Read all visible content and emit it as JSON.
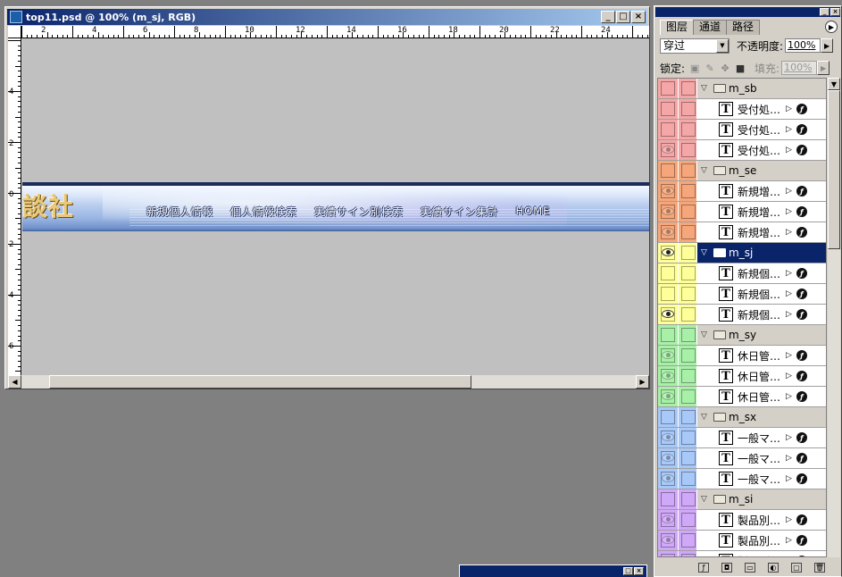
{
  "document": {
    "title": "top11.psd @ 100% (m_sj, RGB)",
    "window_buttons": {
      "minimize": "_",
      "maximize": "□",
      "close": "×"
    },
    "hruler_labels": [
      "2",
      "4",
      "6",
      "8",
      "10",
      "12",
      "14",
      "16",
      "18",
      "20",
      "22",
      "24"
    ],
    "vruler_labels": [
      "4",
      "2",
      "0",
      "2",
      "4",
      "6"
    ],
    "banner": {
      "logo_text": "談社",
      "nav": [
        "新規個人情報",
        "個人情報検索",
        "実績サイン別検索",
        "実績サイン集計",
        "HOME"
      ]
    }
  },
  "layers_panel": {
    "tabs": [
      "图层",
      "通道",
      "路径"
    ],
    "blend_mode": "穿过",
    "opacity_label": "不透明度:",
    "opacity_value": "100%",
    "lock_label": "锁定:",
    "fill_label": "填充:",
    "fill_value": "100%",
    "groups": [
      {
        "name": "m_sb",
        "color": "#f5a6a6",
        "selected": false,
        "layers": [
          {
            "name": "受付処…",
            "eye": false
          },
          {
            "name": "受付処…",
            "eye": false
          },
          {
            "name": "受付処…",
            "eye": true
          }
        ]
      },
      {
        "name": "m_se",
        "color": "#f5a67a",
        "selected": false,
        "layers": [
          {
            "name": "新規增…",
            "eye": true
          },
          {
            "name": "新規增…",
            "eye": true
          },
          {
            "name": "新規增…",
            "eye": true
          }
        ]
      },
      {
        "name": "m_sj",
        "color": "#ffff99",
        "selected": true,
        "layers": [
          {
            "name": "新規個…",
            "eye": false
          },
          {
            "name": "新規個…",
            "eye": false
          },
          {
            "name": "新規個…",
            "eye": true
          }
        ]
      },
      {
        "name": "m_sy",
        "color": "#a8f0a8",
        "selected": false,
        "layers": [
          {
            "name": "休日管…",
            "eye": true
          },
          {
            "name": "休日管…",
            "eye": true
          },
          {
            "name": "休日管…",
            "eye": true
          }
        ]
      },
      {
        "name": "m_sx",
        "color": "#a8c8f8",
        "selected": false,
        "layers": [
          {
            "name": "一般マ…",
            "eye": true
          },
          {
            "name": "一般マ…",
            "eye": true
          },
          {
            "name": "一般マ…",
            "eye": true
          }
        ]
      },
      {
        "name": "m_si",
        "color": "#d0a8f8",
        "selected": false,
        "layers": [
          {
            "name": "製品別…",
            "eye": true
          },
          {
            "name": "製品別…",
            "eye": true
          },
          {
            "name": "製品別…",
            "eye": true
          }
        ]
      }
    ],
    "group_visible": [
      false,
      true,
      true,
      true,
      true,
      true
    ]
  }
}
